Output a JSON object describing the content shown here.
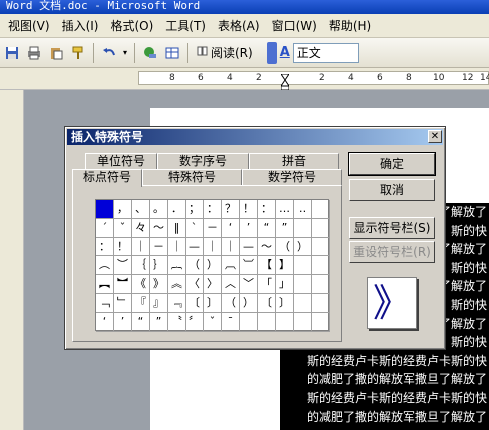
{
  "window": {
    "title": "Word 文档.doc - Microsoft Word"
  },
  "menu": [
    "视图(V)",
    "插入(I)",
    "格式(O)",
    "工具(T)",
    "表格(A)",
    "窗口(W)",
    "帮助(H)"
  ],
  "toolbar": {
    "read_label": "阅读(R)",
    "style_value": "正文",
    "icons": [
      "save-icon",
      "print-icon",
      "paste-icon",
      "format-painter-icon",
      "undo-icon",
      "hyperlink-icon",
      "table-icon",
      "read-icon",
      "font-color-icon"
    ]
  },
  "ruler": {
    "labels": [
      "8",
      "6",
      "4",
      "2",
      "2",
      "4",
      "6",
      "8",
      "10",
      "12",
      "14"
    ]
  },
  "document": {
    "lines": [
      "了解放了",
      "斯的快",
      "了解放了",
      "斯的快",
      "了解放了",
      "斯的快",
      "了解放了",
      "斯的快",
      "斯的经费卢卡斯的经费卢卡斯的快",
      "的减肥了撒的解放军撒旦了解放了",
      "斯的经费卢卡斯的经费卢卡斯的快",
      "的减肥了撒的解放军撒旦了解放了"
    ]
  },
  "dialog": {
    "title": "插入特殊符号",
    "tabs_back": [
      "单位符号",
      "数字序号",
      "拼音"
    ],
    "tabs_front": [
      "标点符号",
      "特殊符号",
      "数学符号"
    ],
    "ok_label": "确定",
    "cancel_label": "取消",
    "show_bar_label": "显示符号栏(S)",
    "reset_bar_label": "重设符号栏(R)",
    "preview_char": "》",
    "grid": [
      [
        "",
        "，",
        "、",
        "。",
        "．",
        "；",
        "：",
        "？",
        "！",
        "：",
        "…",
        "‥",
        ""
      ],
      [
        "ˊ",
        "ˇ",
        "々",
        "～",
        "‖",
        "ˋ",
        "－",
        "‘",
        "’",
        "“",
        "”",
        "",
        ""
      ],
      [
        "：",
        "！",
        "｜",
        "－",
        "｜",
        "—",
        "｜",
        "｜",
        "—",
        "～",
        "（",
        "）",
        ""
      ],
      [
        "︵",
        "︶",
        "｛",
        "｝",
        "︷",
        "（",
        "）",
        "︹",
        "︺",
        "【",
        "】",
        "",
        ""
      ],
      [
        "︻",
        "︼",
        "《",
        "》",
        "︽",
        "〈",
        "〉",
        "︿",
        "﹀",
        "「",
        "」",
        "",
        ""
      ],
      [
        "﹁",
        "﹂",
        "『",
        "』",
        "﹃",
        "〔",
        "〕",
        "（",
        "）",
        "〔",
        "〕",
        "",
        ""
      ],
      [
        "‘",
        "’",
        "“",
        "”",
        "〝",
        "〞",
        "ˇ",
        "ˉ",
        "",
        "",
        "",
        "",
        ""
      ]
    ]
  }
}
